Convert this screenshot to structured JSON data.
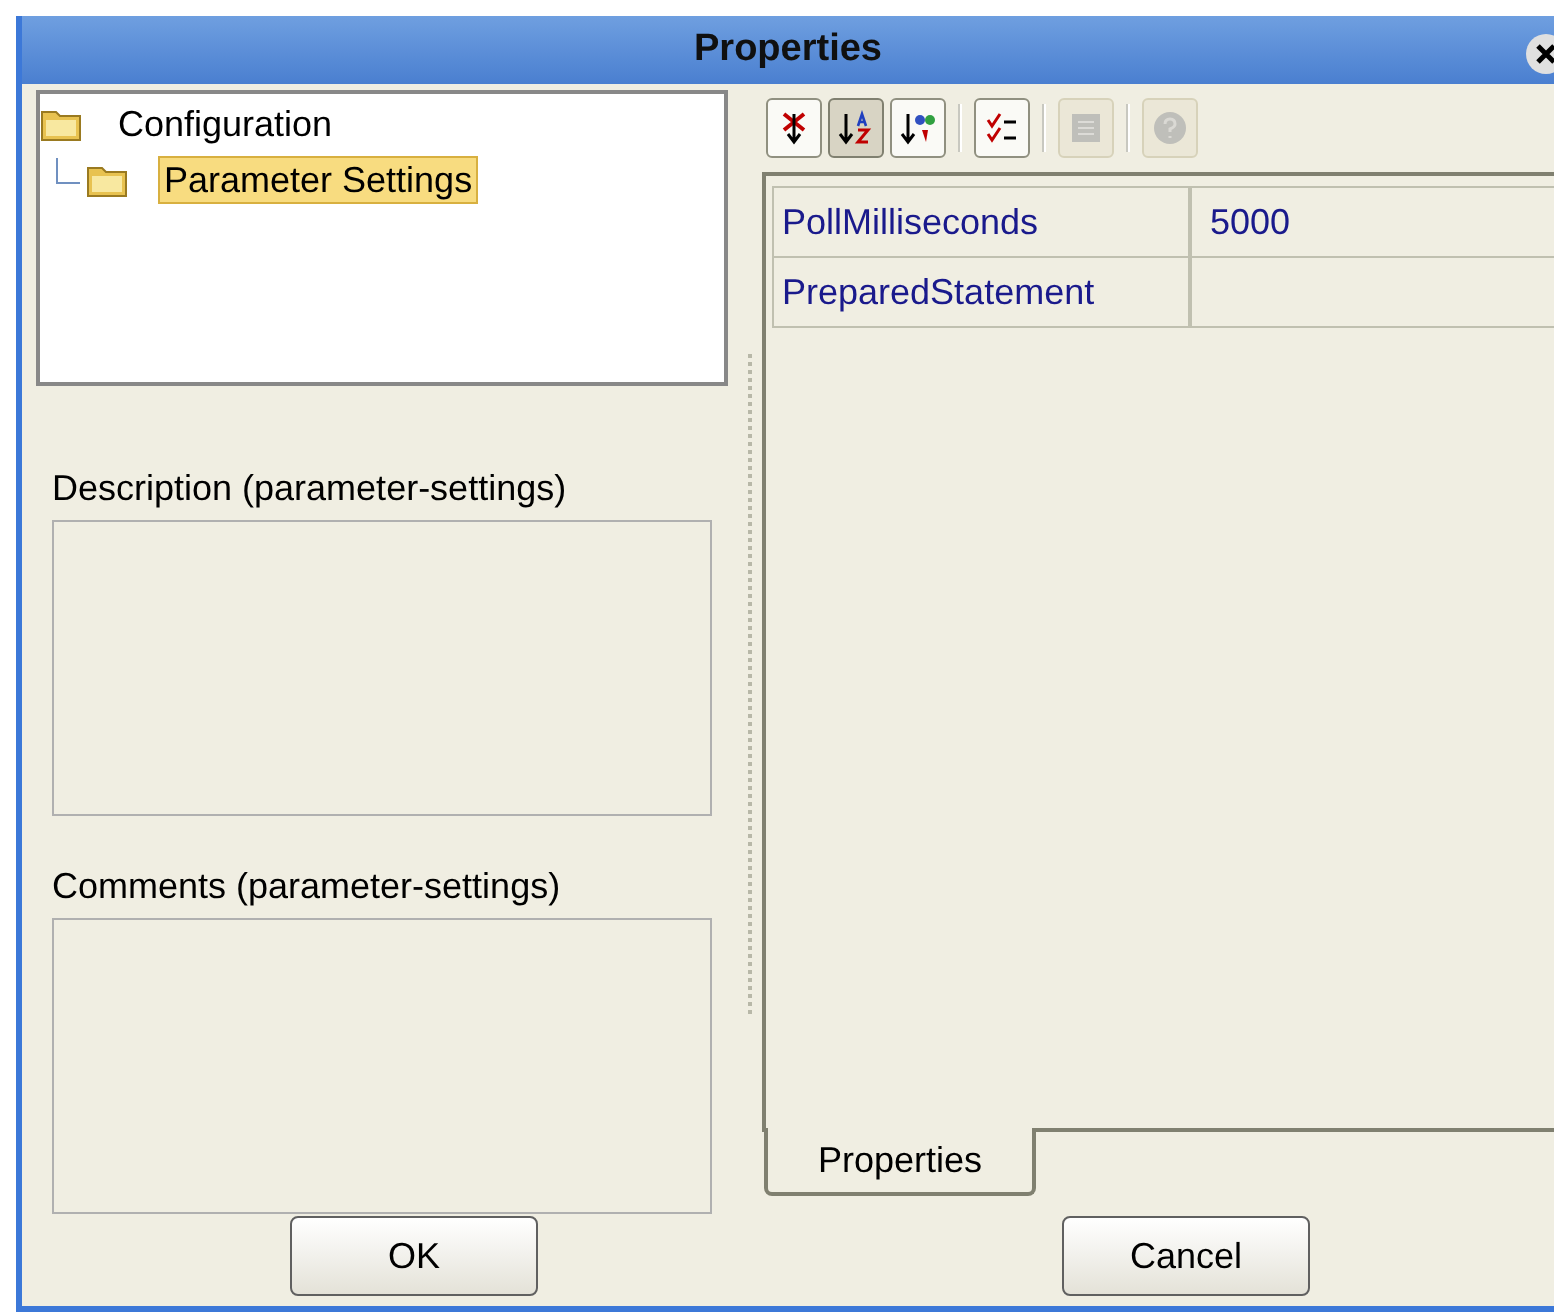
{
  "window": {
    "title": "Properties"
  },
  "tree": [
    {
      "label": "Configuration",
      "selected": false,
      "children": [
        {
          "label": "Parameter Settings",
          "selected": true
        }
      ]
    }
  ],
  "description": {
    "label": "Description (parameter-settings)"
  },
  "comments": {
    "label": "Comments (parameter-settings)"
  },
  "toolbar_groups": [
    [
      {
        "kind": "categorized",
        "selected": false,
        "disabled": false
      },
      {
        "kind": "alphabetical",
        "selected": true,
        "disabled": false
      },
      {
        "kind": "sort-colored",
        "selected": false,
        "disabled": false
      }
    ],
    [
      {
        "kind": "checklist",
        "selected": false,
        "disabled": false
      }
    ],
    [
      {
        "kind": "grid",
        "selected": false,
        "disabled": true
      }
    ],
    [
      {
        "kind": "help",
        "selected": false,
        "disabled": true
      }
    ]
  ],
  "properties": [
    {
      "name": "PollMilliseconds",
      "value": "5000"
    },
    {
      "name": "PreparedStatement"
    }
  ],
  "tabs": [
    {
      "label": "Properties",
      "selected": true
    }
  ],
  "buttons": [
    "OK",
    "Cancel"
  ]
}
